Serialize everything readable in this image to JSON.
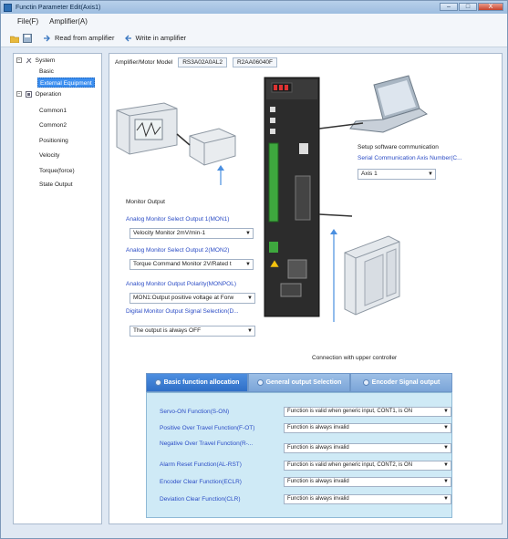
{
  "window": {
    "title": "Functin Parameter Edit(Axis1)",
    "min": "–",
    "max": "□",
    "close": "X"
  },
  "menu": [
    "File(F)",
    "Amplifier(A)"
  ],
  "toolbar": {
    "read_label": "Read from amplifier",
    "write_label": "Write in amplifier"
  },
  "tree": {
    "system": "System",
    "items_system": [
      "Basic",
      "External Equipment"
    ],
    "operation": "Operation",
    "items_operation": [
      "Common1",
      "Common2",
      "Positioning",
      "Velocity",
      "Torque(force)",
      "State Output"
    ]
  },
  "model": {
    "label": "Amplifier/Motor Model",
    "amplifier": "RS3A02A0AL2",
    "motor": "R2AA06040F"
  },
  "setup": {
    "title": "Setup software communication",
    "axis_label": "Serial Communication Axis Number(C...",
    "axis_value": "Axis 1"
  },
  "monitor": {
    "title": "Monitor Output",
    "mon1_label": "Analog Monitor Select Output 1(MON1)",
    "mon1_value": "Velocity Monitor  2mV/min-1",
    "mon2_label": "Analog Monitor Select Output 2(MON2)",
    "mon2_value": "Torque Command Monitor 2V/Rated t",
    "pol_label": "Analog Monitor Output Polarity(MONPOL)",
    "pol_value": "MON1:Output positive voltage at Forw",
    "dig_label": "Digital Monitor Output Signal Selection(D...",
    "dig_value": "The output is always OFF"
  },
  "upper_label": "Connection with upper controller",
  "tabs": [
    "Basic function allocation",
    "General output Selection",
    "Encoder Signal output"
  ],
  "functions": [
    {
      "label": "Servo-ON Function(S-ON)",
      "value": "Function is valid when generic input, CONT1, is ON"
    },
    {
      "label": "Positive Over Travel Function(F-OT)",
      "value": "Function is always invalid"
    },
    {
      "label": "Negative Over Travel Function(R-...",
      "value": "Function is always invalid"
    },
    {
      "label": "Alarm Reset Function(AL-RST)",
      "value": "Function is valid when generic input, CONT2, is ON"
    },
    {
      "label": "Encoder Clear Function(ECLR)",
      "value": "Function is always invalid"
    },
    {
      "label": "Deviation Clear Function(CLR)",
      "value": "Function is always invalid"
    }
  ],
  "colors": {
    "accent": "#2f6fc7",
    "label_blue": "#2b4cc5",
    "panel": "#cfeaf6",
    "connector": "#4a8fe0"
  }
}
